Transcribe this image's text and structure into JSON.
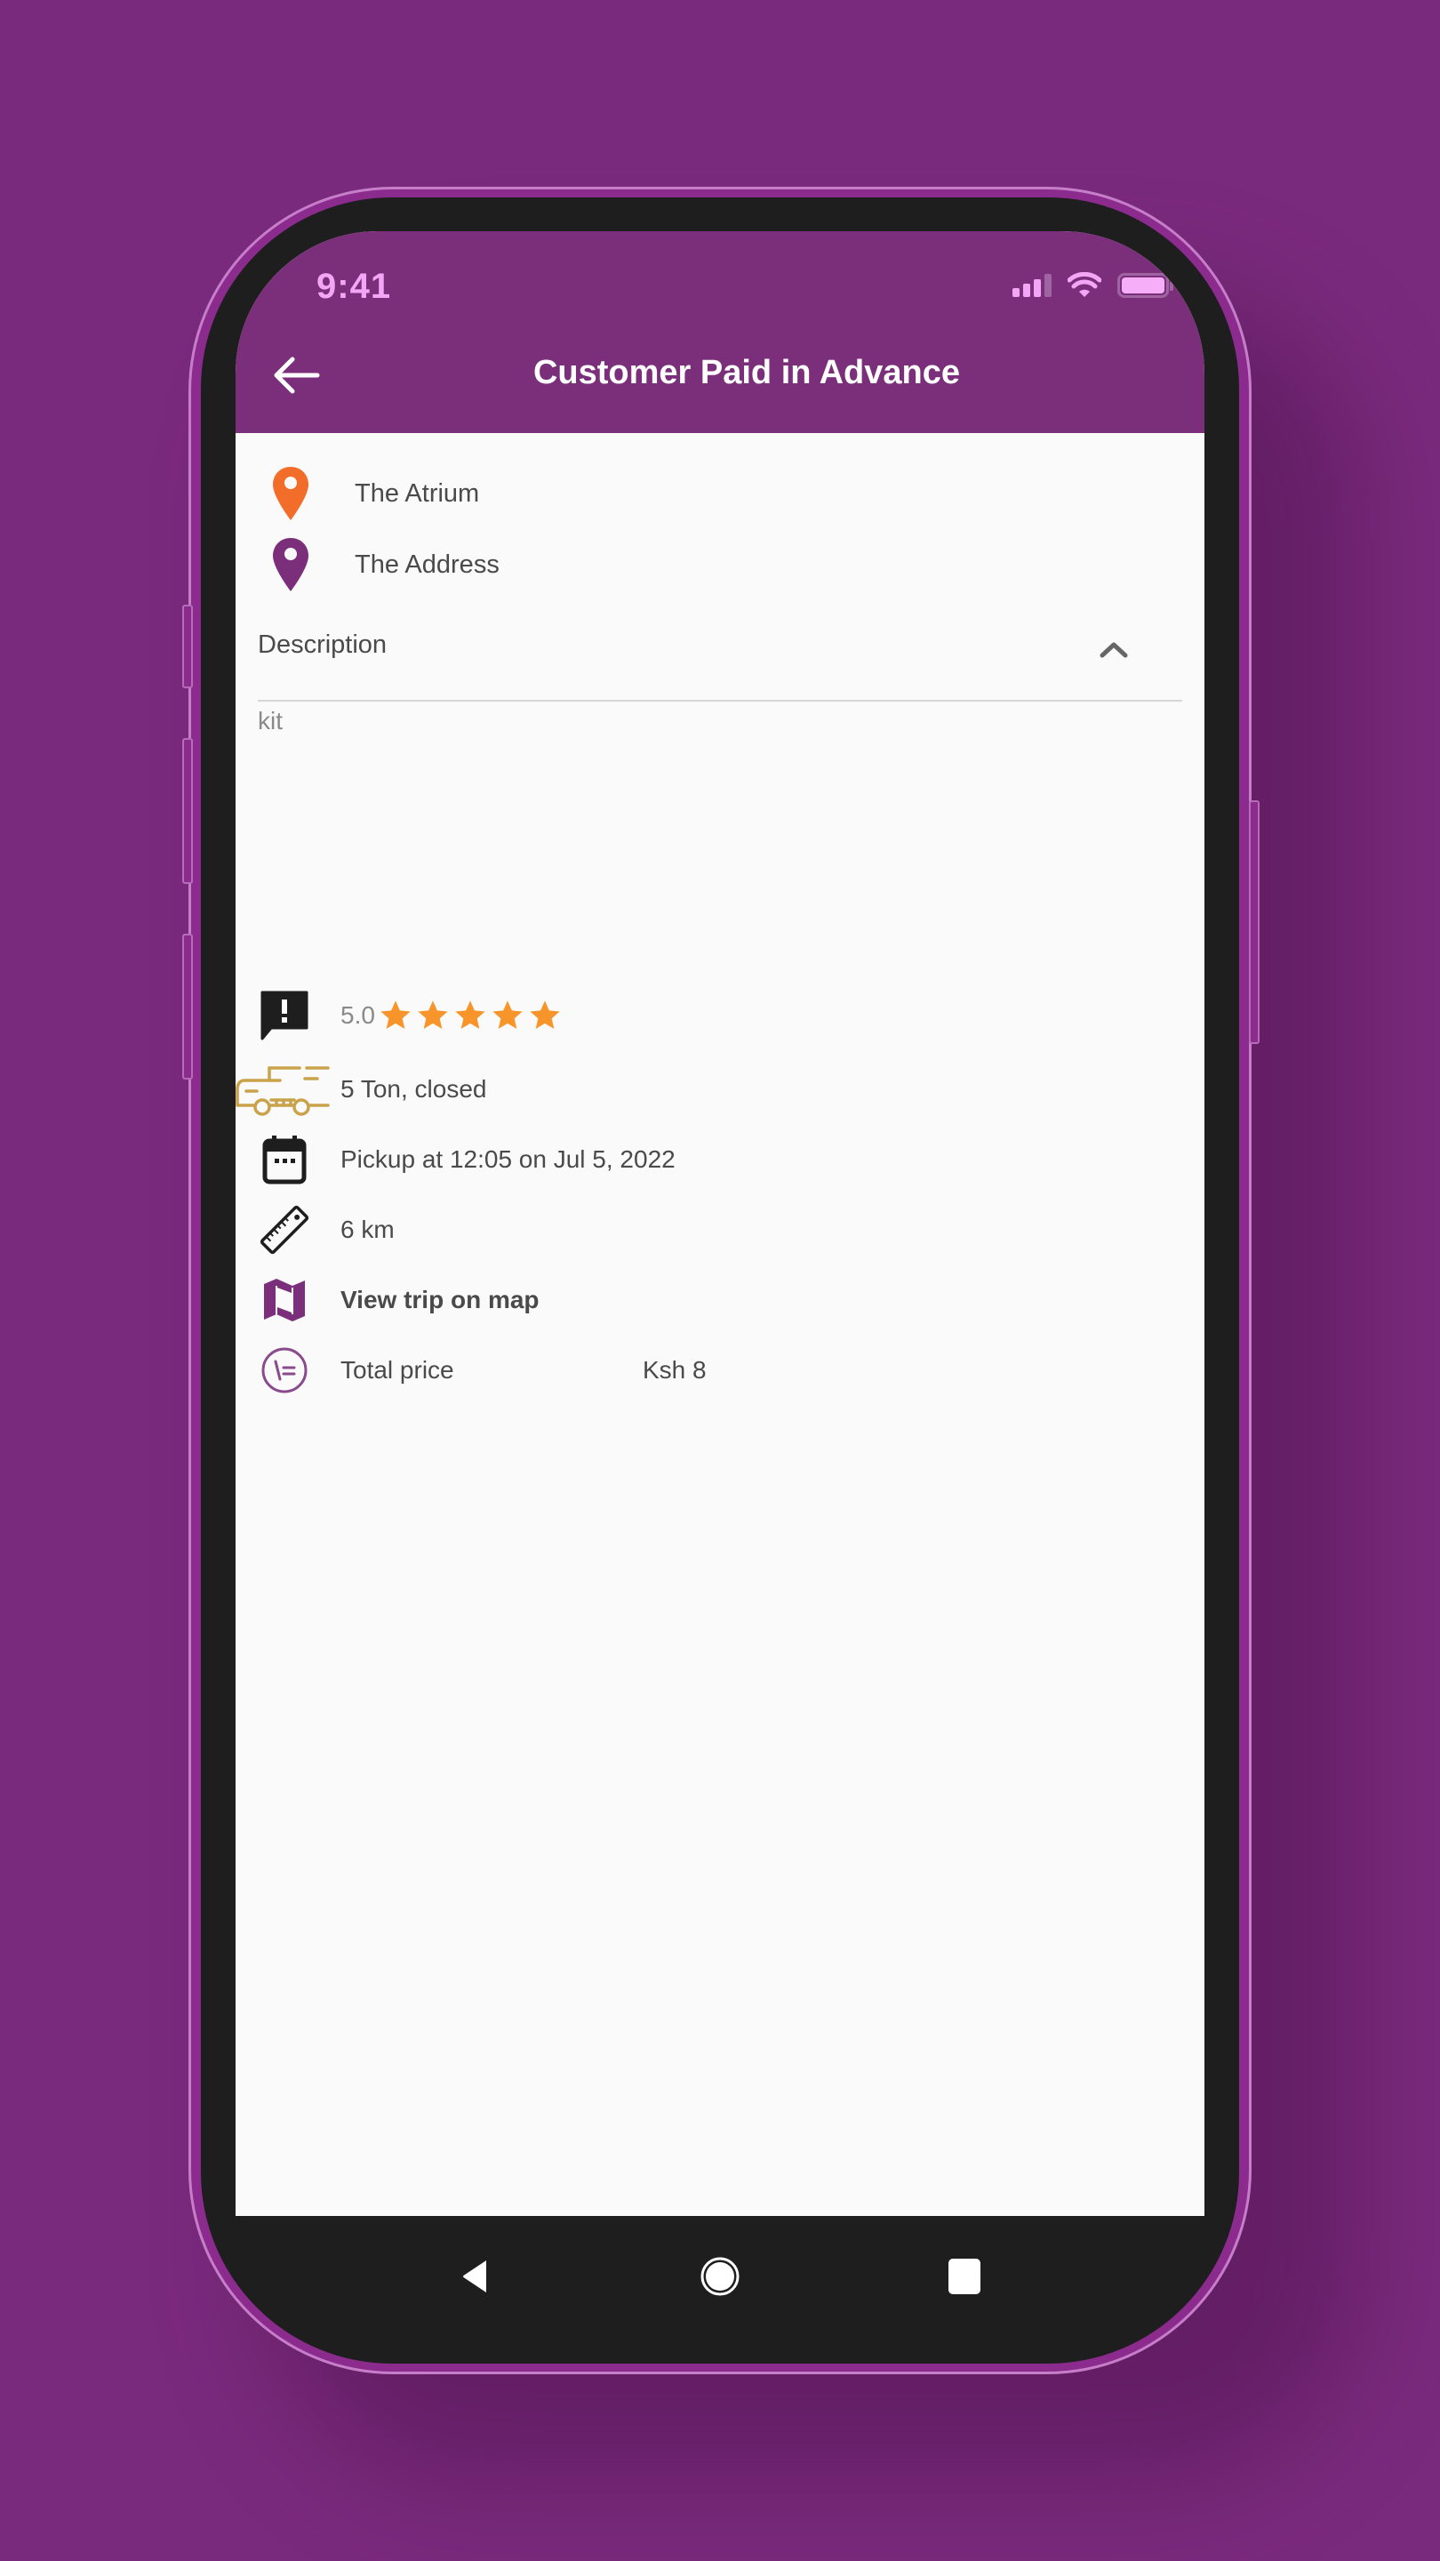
{
  "status_bar": {
    "time": "9:41",
    "signal_bars_active": 3,
    "signal_bars_total": 4,
    "wifi": "connected",
    "battery_level_percent": 100
  },
  "header": {
    "title": "Customer Paid in Advance",
    "back_icon": "arrow-left-icon"
  },
  "locations": {
    "pickup": {
      "label": "The Atrium",
      "icon": "map-pin-icon",
      "color": "#f26c2a"
    },
    "dropoff": {
      "label": "The Address",
      "icon": "map-pin-icon",
      "color": "#7b2f7b"
    }
  },
  "description": {
    "label": "Description",
    "expanded": true,
    "toggle_icon": "chevron-up-icon",
    "text": "kit"
  },
  "details": {
    "rating": {
      "value": "5.0",
      "stars": 5,
      "max_stars": 5,
      "icon": "feedback-icon",
      "star_color": "#f7952a"
    },
    "vehicle": {
      "text": "5 Ton, closed",
      "icon": "truck-icon",
      "color": "#c9a24a"
    },
    "pickup_time": {
      "text": "Pickup at 12:05 on Jul 5, 2022",
      "icon": "calendar-icon"
    },
    "distance": {
      "text": "6 km",
      "icon": "ruler-icon"
    },
    "map_link": {
      "text": "View trip on map",
      "icon": "map-icon",
      "color": "#7b2f7b"
    },
    "price": {
      "label": "Total price",
      "value": "Ksh 8",
      "icon": "price-icon"
    }
  },
  "nav_bar": {
    "back": "nav-back-icon",
    "home": "nav-home-icon",
    "recents": "nav-recents-icon"
  },
  "colors": {
    "brand": "#7b2f7b",
    "background": "#7a2a7c",
    "status_accent": "#f3a6f5"
  }
}
